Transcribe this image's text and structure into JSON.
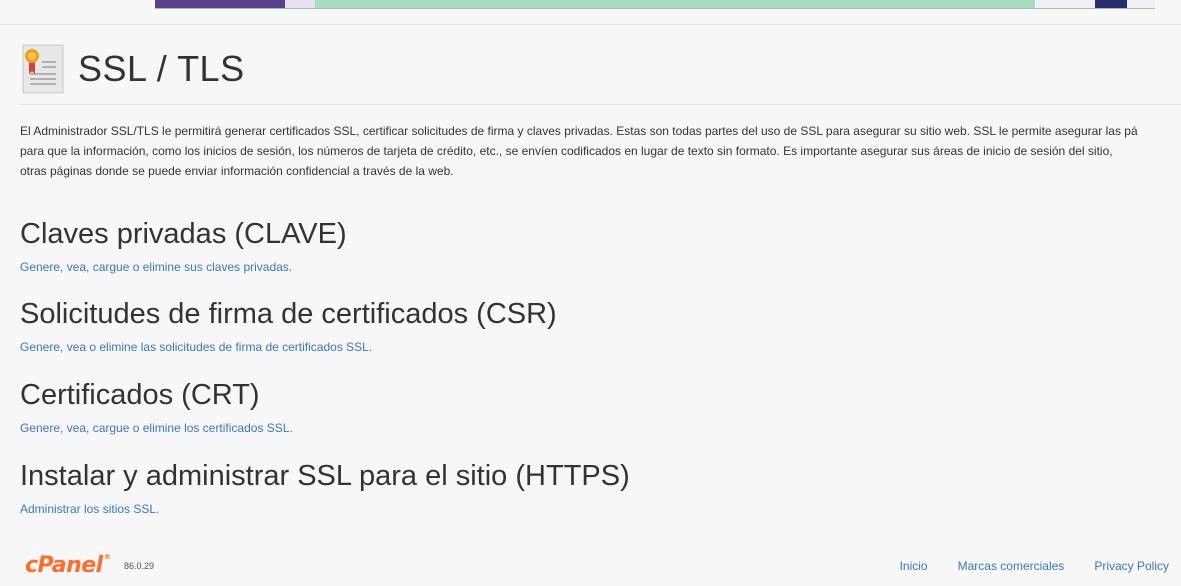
{
  "page": {
    "title": "SSL / TLS",
    "description_lines": [
      "El Administrador SSL/TLS le permitirá generar certificados SSL, certificar solicitudes de firma y claves privadas. Estas son todas partes del uso de SSL para asegurar su sitio web. SSL le permite asegurar las pá",
      "para que la información, como los inicios de sesión, los números de tarjeta de crédito, etc., se envíen codificados en lugar de texto sin formato. Es importante asegurar sus áreas de inicio de sesión del sitio,",
      "otras páginas donde se puede enviar información confidencial a través de la web."
    ]
  },
  "sections": [
    {
      "heading": "Claves privadas (CLAVE)",
      "link": "Genere, vea, cargue o elimine sus claves privadas."
    },
    {
      "heading": "Solicitudes de firma de certificados (CSR)",
      "link": "Genere, vea o elimine las solicitudes de firma de certificados SSL."
    },
    {
      "heading": "Certificados (CRT)",
      "link": "Genere, vea, cargue o elimine los certificados SSL."
    },
    {
      "heading": "Instalar y administrar SSL para el sitio (HTTPS)",
      "link": "Administrar los sitios SSL."
    }
  ],
  "footer": {
    "logo_text": "cPanel",
    "logo_reg": "®",
    "version": "86.0.29",
    "links": [
      "Inicio",
      "Marcas comerciales",
      "Privacy Policy"
    ]
  },
  "colors": {
    "link": "#3b78b8",
    "brand": "#ff6c2c",
    "text": "#333333",
    "background": "#f7f7f7"
  },
  "icons": {
    "page_icon": "ssl-certificate-icon"
  }
}
